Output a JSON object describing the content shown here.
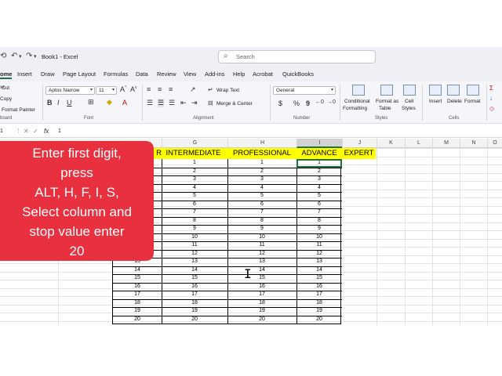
{
  "titlebar": {
    "book_title": "Book1 - Excel",
    "search_placeholder": "Search"
  },
  "menu": {
    "items": [
      "ome",
      "Insert",
      "Draw",
      "Page Layout",
      "Formulas",
      "Data",
      "Review",
      "View",
      "Add-ins",
      "Help",
      "Acrobat",
      "QuickBooks"
    ]
  },
  "ribbon": {
    "clipboard": {
      "cut": "Cut",
      "copy": "Copy",
      "format_painter": "Format Painter",
      "label": "board"
    },
    "font": {
      "name": "Aptos Narrow",
      "size": "11",
      "label": "Font"
    },
    "alignment": {
      "wrap_text": "Wrap Text",
      "merge_center": "Merge & Center",
      "label": "Alignment"
    },
    "number": {
      "format": "General",
      "dollar": "$",
      "percent": "%",
      "comma": "9",
      "label": "Number"
    },
    "styles": {
      "conditional": "Conditional",
      "formatting": "Formatting",
      "format_as": "Format as",
      "table": "Table",
      "cell": "Cell",
      "cell_styles": "Styles",
      "label": "Styles"
    },
    "cells": {
      "insert": "Insert",
      "delete": "Delete",
      "format": "Format",
      "label": "Cells"
    }
  },
  "formula_bar": {
    "cell_ref": "1",
    "fx": "fx",
    "value": "1"
  },
  "columns": [
    "G",
    "H",
    "I",
    "J",
    "K",
    "L",
    "M",
    "N",
    "O"
  ],
  "sheet": {
    "headers": [
      "R",
      "INTERMEDIATE",
      "PROFESSIONAL",
      "ADVANCE",
      "EXPERT"
    ],
    "row_count": 20,
    "rows": [
      {
        "f": "",
        "g": "1",
        "h": "1",
        "i": "1"
      },
      {
        "f": "",
        "g": "2",
        "h": "2",
        "i": "2"
      },
      {
        "f": "",
        "g": "3",
        "h": "3",
        "i": "3"
      },
      {
        "f": "",
        "g": "4",
        "h": "4",
        "i": "4"
      },
      {
        "f": "",
        "g": "5",
        "h": "5",
        "i": "5"
      },
      {
        "f": "",
        "g": "6",
        "h": "6",
        "i": "6"
      },
      {
        "f": "",
        "g": "7",
        "h": "7",
        "i": "7"
      },
      {
        "f": "",
        "g": "8",
        "h": "8",
        "i": "8"
      },
      {
        "f": "",
        "g": "9",
        "h": "9",
        "i": "9"
      },
      {
        "f": "",
        "g": "10",
        "h": "10",
        "i": "10"
      },
      {
        "f": "",
        "g": "11",
        "h": "11",
        "i": "11"
      },
      {
        "f": "",
        "g": "12",
        "h": "12",
        "i": "12"
      },
      {
        "f": "13",
        "g": "13",
        "h": "13",
        "i": "13"
      },
      {
        "f": "14",
        "g": "14",
        "h": "14",
        "i": "14"
      },
      {
        "f": "15",
        "g": "15",
        "h": "15",
        "i": "15"
      },
      {
        "f": "16",
        "g": "16",
        "h": "16",
        "i": "16"
      },
      {
        "f": "17",
        "g": "17",
        "h": "17",
        "i": "17"
      },
      {
        "f": "18",
        "g": "18",
        "h": "18",
        "i": "18"
      },
      {
        "f": "19",
        "g": "19",
        "h": "19",
        "i": "19"
      },
      {
        "f": "20",
        "g": "20",
        "h": "20",
        "i": "20"
      }
    ]
  },
  "callout": {
    "lines": [
      "Enter first digit,",
      "press",
      "ALT, H, F, I, S,",
      "Select column and",
      "stop value enter",
      "20"
    ],
    "color": "#e8303f"
  },
  "colors": {
    "header_fill": "#ffff00",
    "selection": "#1e7145",
    "titlebar": "#eef0f6"
  }
}
